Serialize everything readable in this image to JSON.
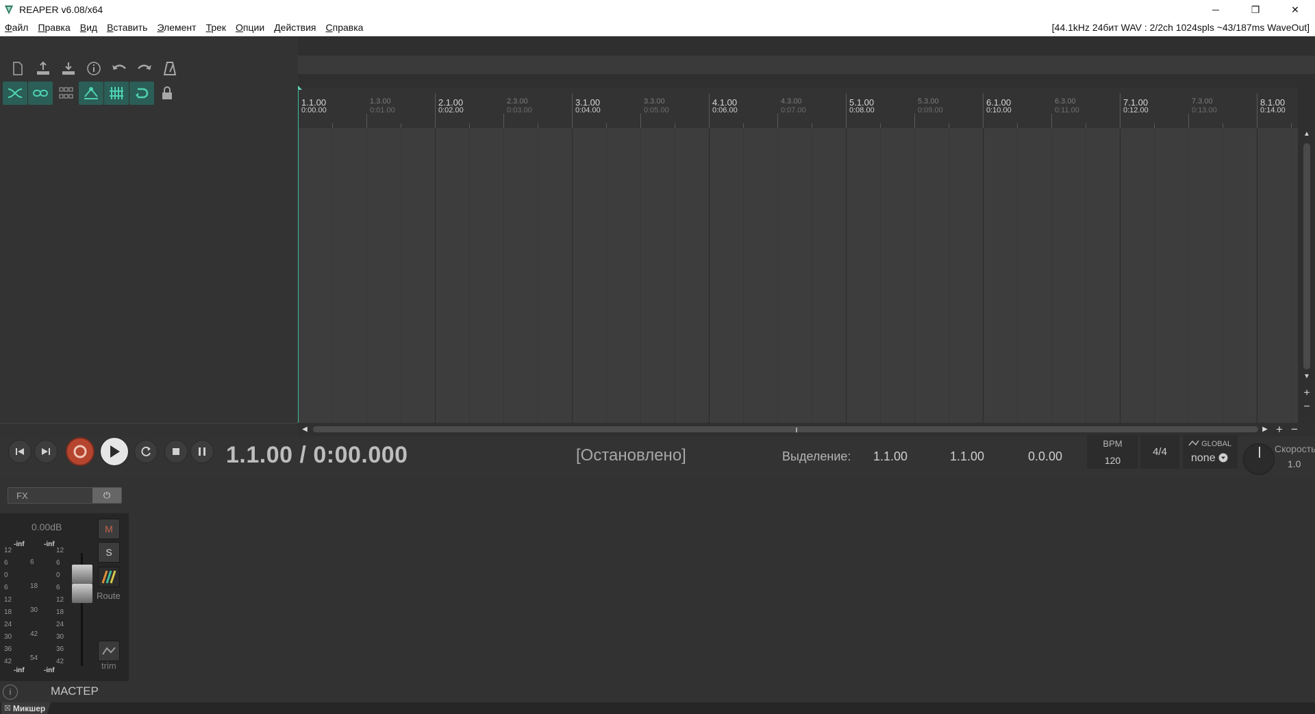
{
  "window": {
    "title": "REAPER v6.08/x64",
    "minimize": "─",
    "restore": "❐",
    "close": "✕"
  },
  "menu": {
    "items": [
      "Файл",
      "Правка",
      "Вид",
      "Вставить",
      "Элемент",
      "Трек",
      "Опции",
      "Действия",
      "Справка"
    ],
    "audio_status": "[44.1kHz 24бит WAV : 2/2ch 1024spls ~43/187ms WaveOut]"
  },
  "ruler": {
    "major": [
      {
        "bar": "1.1.00",
        "time": "0:00.00"
      },
      {
        "bar": "2.1.00",
        "time": "0:02.00"
      },
      {
        "bar": "3.1.00",
        "time": "0:04.00"
      },
      {
        "bar": "4.1.00",
        "time": "0:06.00"
      },
      {
        "bar": "5.1.00",
        "time": "0:08.00"
      },
      {
        "bar": "6.1.00",
        "time": "0:10.00"
      },
      {
        "bar": "7.1.00",
        "time": "0:12.00"
      },
      {
        "bar": "8.1.00",
        "time": "0:14.00"
      }
    ],
    "minor": [
      {
        "bar": "1.3.00",
        "time": "0:01.00"
      },
      {
        "bar": "2.3.00",
        "time": "0:03.00"
      },
      {
        "bar": "3.3.00",
        "time": "0:05.00"
      },
      {
        "bar": "4.3.00",
        "time": "0:07.00"
      },
      {
        "bar": "5.3.00",
        "time": "0:09.00"
      },
      {
        "bar": "6.3.00",
        "time": "0:11.00"
      },
      {
        "bar": "7.3.00",
        "time": "0:13.00"
      }
    ]
  },
  "transport": {
    "position": "1.1.00 / 0:00.000",
    "state": "[Остановлено]",
    "selection_label": "Выделение:",
    "selection_start": "1.1.00",
    "selection_end": "1.1.00",
    "selection_length": "0.0.00",
    "bpm_label": "BPM",
    "bpm": "120",
    "time_signature": "4/4",
    "global_label": "GLOBAL",
    "global_value": "none",
    "rate_label": "Скорость",
    "rate": "1.0"
  },
  "mixer": {
    "fx_label": "FX",
    "master_volume": "0.00dB",
    "peak_left": "-inf",
    "peak_right": "-inf",
    "bottom_left": "-inf",
    "bottom_right": "-inf",
    "mute": "M",
    "solo": "S",
    "route": "Route",
    "trim": "trim",
    "master_name": "МАСТЕР",
    "scale_left": [
      "12",
      "6",
      "0",
      "6",
      "12",
      "18",
      "24",
      "30",
      "36",
      "42"
    ],
    "scale_mid": [
      "6",
      "18",
      "30",
      "42",
      "54"
    ],
    "scale_right": [
      "12",
      "6",
      "0",
      "6",
      "12",
      "18",
      "24",
      "30",
      "36",
      "42"
    ]
  },
  "docker": {
    "tab_label": "Микшер"
  },
  "colors": {
    "accent": "#3fbf9e",
    "record": "#b5452f",
    "background": "#323232"
  }
}
